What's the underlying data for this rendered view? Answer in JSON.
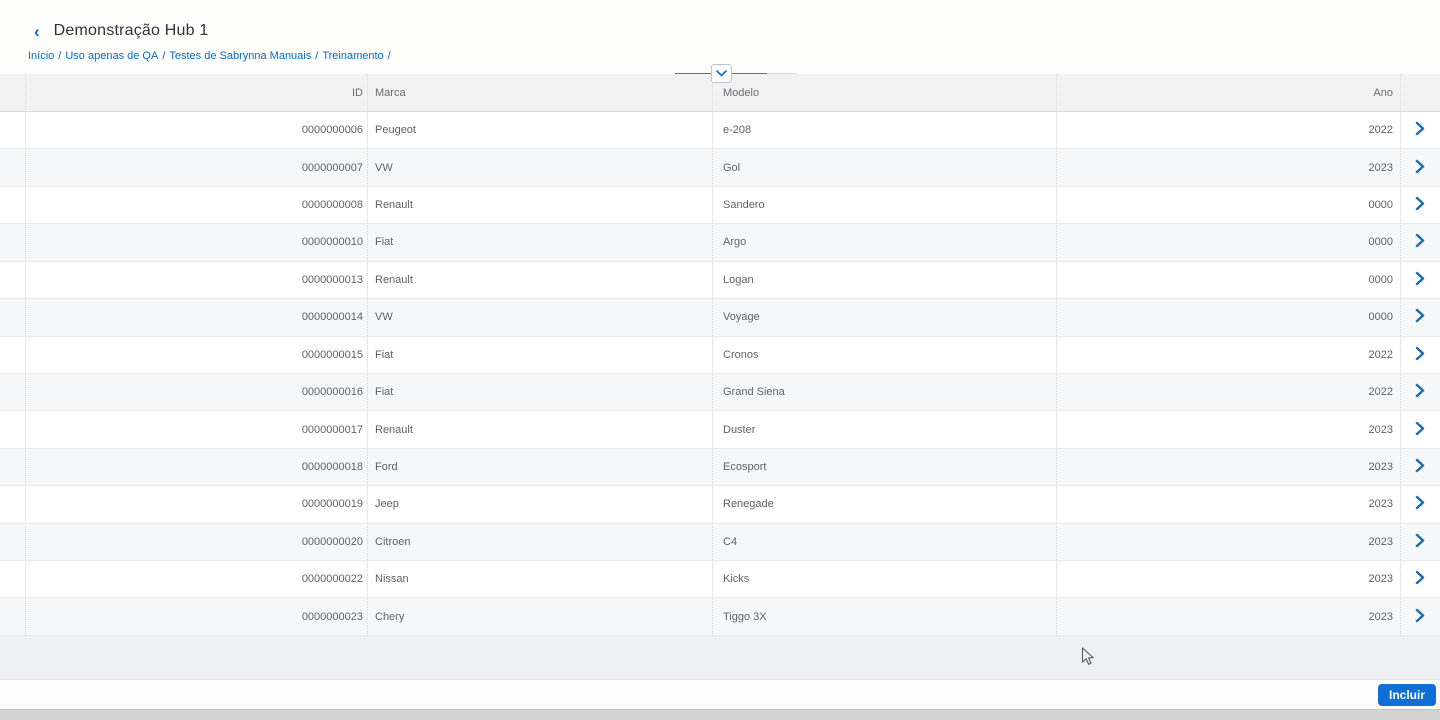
{
  "header": {
    "back_icon": "‹",
    "title": "Demonstração Hub 1",
    "breadcrumb": {
      "items": [
        "Início",
        "Uso apenas de QA",
        "Testes de Sabrynna Manuais",
        "Treinamento"
      ],
      "separator": "/",
      "trailing_separator": "/"
    }
  },
  "table": {
    "columns": [
      {
        "key": "id",
        "label": "ID",
        "align": "right"
      },
      {
        "key": "marca",
        "label": "Marca",
        "align": "left"
      },
      {
        "key": "modelo",
        "label": "Modelo",
        "align": "left"
      },
      {
        "key": "ano",
        "label": "Ano",
        "align": "right"
      }
    ],
    "rows": [
      {
        "id": "0000000006",
        "marca": "Peugeot",
        "modelo": "e-208",
        "ano": "2022"
      },
      {
        "id": "0000000007",
        "marca": "VW",
        "modelo": "Gol",
        "ano": "2023"
      },
      {
        "id": "0000000008",
        "marca": "Renault",
        "modelo": "Sandero",
        "ano": "0000"
      },
      {
        "id": "0000000010",
        "marca": "Fiat",
        "modelo": "Argo",
        "ano": "0000"
      },
      {
        "id": "0000000013",
        "marca": "Renault",
        "modelo": "Logan",
        "ano": "0000"
      },
      {
        "id": "0000000014",
        "marca": "VW",
        "modelo": "Voyage",
        "ano": "0000"
      },
      {
        "id": "0000000015",
        "marca": "Fiat",
        "modelo": "Cronos",
        "ano": "2022"
      },
      {
        "id": "0000000016",
        "marca": "Fiat",
        "modelo": "Grand Siena",
        "ano": "2022"
      },
      {
        "id": "0000000017",
        "marca": "Renault",
        "modelo": "Duster",
        "ano": "2023"
      },
      {
        "id": "0000000018",
        "marca": "Ford",
        "modelo": "Ecosport",
        "ano": "2023"
      },
      {
        "id": "0000000019",
        "marca": "Jeep",
        "modelo": "Renegade",
        "ano": "2023"
      },
      {
        "id": "0000000020",
        "marca": "Citroen",
        "modelo": "C4",
        "ano": "2023"
      },
      {
        "id": "0000000022",
        "marca": "Nissan",
        "modelo": "Kicks",
        "ano": "2023"
      },
      {
        "id": "0000000023",
        "marca": "Chery",
        "modelo": "Tiggo 3X",
        "ano": "2023"
      }
    ]
  },
  "footer": {
    "incluir_label": "Incluir"
  },
  "colors": {
    "link_blue": "#0b6cc1",
    "row_chevron_blue": "#1a6cae",
    "button_blue": "#0f6fd7",
    "header_row_bg": "#f2f2f2",
    "zebra_row_bg": "#f6f7f8"
  }
}
